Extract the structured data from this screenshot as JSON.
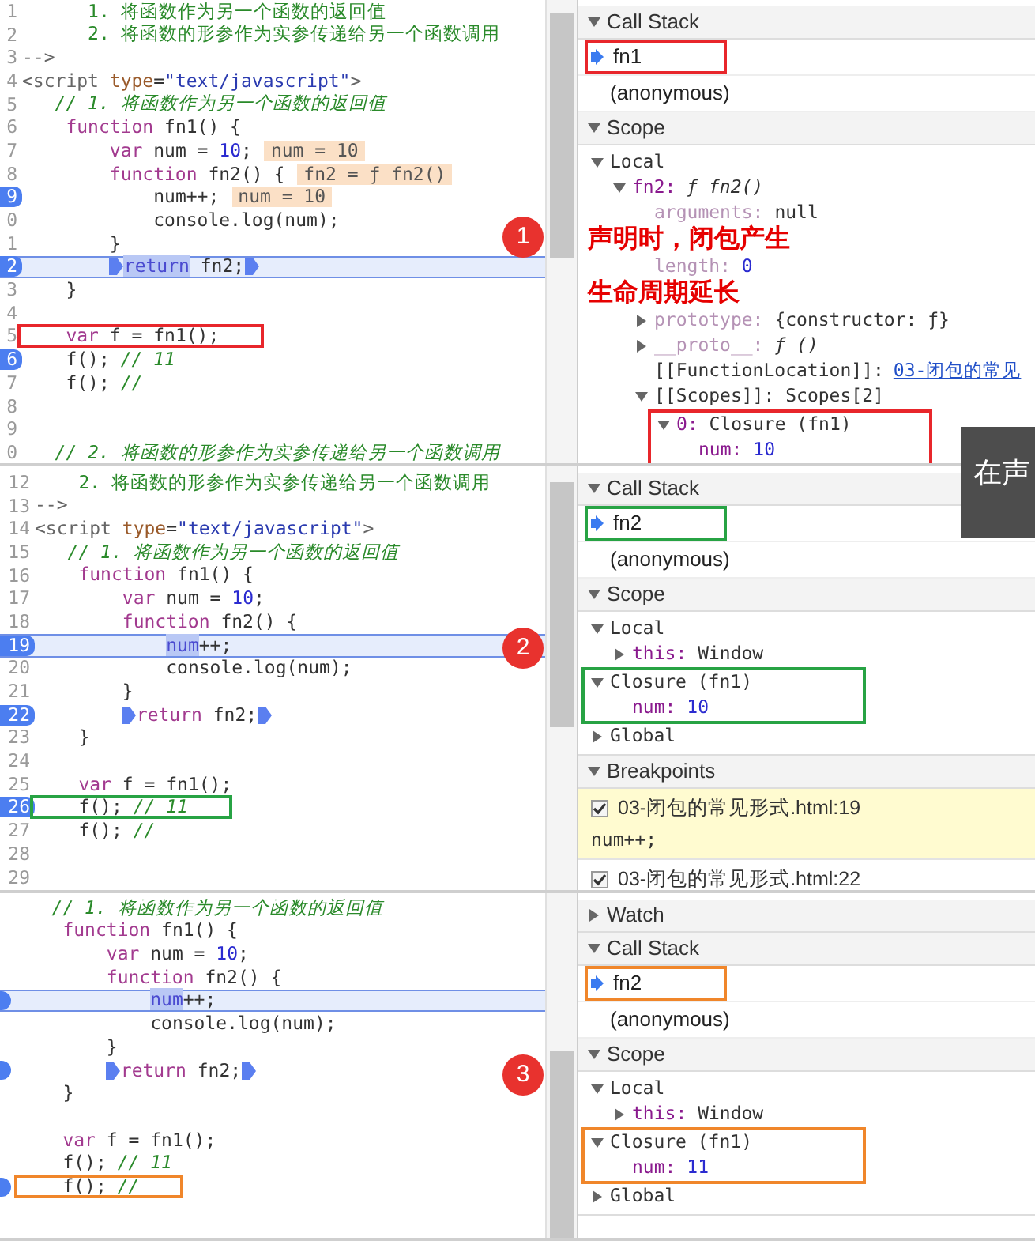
{
  "panels": [
    {
      "badge": "1",
      "color": "#e8262b",
      "code": [
        {
          "number": "1",
          "segments": [
            {
              "text": "      1. 将函数作为另一个函数的返回值",
              "kind": "doc"
            }
          ],
          "breakpoint": false,
          "current": false,
          "outlined": false
        },
        {
          "number": "2",
          "segments": [
            {
              "text": "      2. 将函数的形参作为实参传递给另一个函数调用",
              "kind": "doc"
            }
          ],
          "breakpoint": false,
          "current": false,
          "outlined": false
        },
        {
          "number": "3",
          "segments": [
            {
              "text": "-->",
              "kind": "tag"
            }
          ],
          "breakpoint": false,
          "current": false,
          "outlined": false
        },
        {
          "number": "4",
          "segments": [
            {
              "text": "<script",
              "kind": "tag"
            },
            {
              "text": " type",
              "kind": "attr"
            },
            {
              "text": "=",
              "kind": "plain"
            },
            {
              "text": "\"text/javascript\"",
              "kind": "string"
            },
            {
              "text": ">",
              "kind": "tag"
            }
          ],
          "breakpoint": false,
          "current": false,
          "outlined": false
        },
        {
          "number": "5",
          "segments": [
            {
              "text": "   // 1. 将函数作为另一个函数的返回值",
              "kind": "comment"
            }
          ],
          "breakpoint": false,
          "current": false,
          "outlined": false
        },
        {
          "number": "6",
          "segments": [
            {
              "text": "    function",
              "kind": "keyword"
            },
            {
              "text": " fn1() {",
              "kind": "plain"
            }
          ],
          "breakpoint": false,
          "current": false,
          "outlined": false
        },
        {
          "number": "7",
          "segments": [
            {
              "text": "        var",
              "kind": "keyword"
            },
            {
              "text": " num = ",
              "kind": "plain"
            },
            {
              "text": "10",
              "kind": "number"
            },
            {
              "text": ";",
              "kind": "plain"
            }
          ],
          "value": "num = 10",
          "breakpoint": false,
          "current": false,
          "outlined": false
        },
        {
          "number": "8",
          "segments": [
            {
              "text": "        function",
              "kind": "keyword"
            },
            {
              "text": " fn2() {",
              "kind": "plain"
            }
          ],
          "value": "fn2 = ƒ fn2()",
          "breakpoint": false,
          "current": false,
          "outlined": false
        },
        {
          "number": "9",
          "segments": [
            {
              "text": "            num++;",
              "kind": "plain"
            }
          ],
          "value": "num = 10",
          "breakpoint": true,
          "current": false,
          "outlined": false
        },
        {
          "number": "0",
          "segments": [
            {
              "text": "            console.log(num);",
              "kind": "plain"
            }
          ],
          "breakpoint": false,
          "current": false,
          "outlined": false
        },
        {
          "number": "1",
          "segments": [
            {
              "text": "        }",
              "kind": "plain"
            }
          ],
          "breakpoint": false,
          "current": false,
          "outlined": false
        },
        {
          "number": "2",
          "segments": [
            {
              "kind": "marker"
            },
            {
              "text": "        return",
              "kind": "selection"
            },
            {
              "text": " fn2;",
              "kind": "plain"
            },
            {
              "kind": "marker"
            }
          ],
          "breakpoint": true,
          "current": true,
          "outlined": false
        },
        {
          "number": "3",
          "segments": [
            {
              "text": "    }",
              "kind": "plain"
            }
          ],
          "breakpoint": false,
          "current": false,
          "outlined": false
        },
        {
          "number": "4",
          "breakpoint": false,
          "current": false,
          "outlined": false
        },
        {
          "number": "5",
          "segments": [
            {
              "text": "    var",
              "kind": "keyword"
            },
            {
              "text": " f = fn1();",
              "kind": "plain"
            }
          ],
          "breakpoint": false,
          "current": false,
          "outlined": true
        },
        {
          "number": "6",
          "segments": [
            {
              "text": "    f(); ",
              "kind": "plain"
            },
            {
              "text": "// 11",
              "kind": "comment"
            }
          ],
          "breakpoint": true,
          "current": false,
          "outlined": false
        },
        {
          "number": "7",
          "segments": [
            {
              "text": "    f(); ",
              "kind": "plain"
            },
            {
              "text": "//",
              "kind": "comment"
            }
          ],
          "breakpoint": false,
          "current": false,
          "outlined": false
        },
        {
          "number": "8",
          "breakpoint": false,
          "current": false,
          "outlined": false
        },
        {
          "number": "9",
          "breakpoint": false,
          "current": false,
          "outlined": false
        },
        {
          "number": "0",
          "segments": [
            {
              "text": "   // 2. 将函数的形参作为实参传递给另一个函数调用",
              "kind": "comment"
            }
          ],
          "breakpoint": false,
          "current": false,
          "outlined": false
        }
      ],
      "sidebar": [
        {
          "kind": "section",
          "title": "Call Stack",
          "expanded": true
        },
        {
          "kind": "frame",
          "name": "fn1",
          "active": true,
          "outlined": true
        },
        {
          "kind": "frame",
          "name": "(anonymous)",
          "active": false,
          "outlined": false
        },
        {
          "kind": "section",
          "title": "Scope",
          "expanded": true
        },
        {
          "kind": "tree",
          "nodes": [
            {
              "kind": "scope",
              "label": "Local",
              "expanded": true,
              "outlined": false,
              "children": [
                {
                  "kind": "property",
                  "key": "fn2:",
                  "value": {
                    "text": "ƒ fn2()",
                    "kind": "function"
                  },
                  "expanded": true,
                  "outlined": false,
                  "children": [
                    {
                      "kind": "hidden_property",
                      "key": "arguments:",
                      "value": {
                        "text": "null",
                        "kind": "object"
                      },
                      "outlined": false
                    },
                    {
                      "kind": "note",
                      "text": "声明时，闭包产生"
                    },
                    {
                      "kind": "hidden_property",
                      "key": "length:",
                      "value": {
                        "text": "0",
                        "kind": "number"
                      },
                      "outlined": false
                    },
                    {
                      "kind": "note",
                      "text": "生命周期延长"
                    },
                    {
                      "kind": "hidden_property",
                      "key": "prototype:",
                      "value": {
                        "text": "{constructor: ƒ}",
                        "kind": "object"
                      },
                      "expanded": false,
                      "outlined": false
                    },
                    {
                      "kind": "hidden_property",
                      "key": "__proto__:",
                      "value": {
                        "text": "ƒ ()",
                        "kind": "function"
                      },
                      "expanded": false,
                      "outlined": false
                    },
                    {
                      "kind": "internal",
                      "key": "[[FunctionLocation]]:",
                      "link": "03-闭包的常见",
                      "outlined": false
                    },
                    {
                      "kind": "internal",
                      "key": "[[Scopes]]:",
                      "value": {
                        "text": "Scopes[2]",
                        "kind": "object"
                      },
                      "expanded": true,
                      "outlined": false,
                      "children": [
                        {
                          "kind": "property",
                          "key": "0:",
                          "value": {
                            "text": "Closure (fn1)",
                            "kind": "object"
                          },
                          "expanded": true,
                          "outlined": true,
                          "children": [
                            {
                              "kind": "property",
                              "key": "num:",
                              "value": {
                                "text": "10",
                                "kind": "number"
                              },
                              "outlined": false
                            }
                          ]
                        }
                      ]
                    }
                  ]
                }
              ]
            }
          ]
        }
      ]
    },
    {
      "badge": "2",
      "color": "#27a344",
      "code": [
        {
          "number": "12",
          "segments": [
            {
              "text": "    2. 将函数的形参作为实参传递给另一个函数调用",
              "kind": "doc"
            }
          ],
          "breakpoint": false,
          "current": false,
          "outlined": false
        },
        {
          "number": "13",
          "segments": [
            {
              "text": "-->",
              "kind": "tag"
            }
          ],
          "breakpoint": false,
          "current": false,
          "outlined": false
        },
        {
          "number": "14",
          "segments": [
            {
              "text": "<script",
              "kind": "tag"
            },
            {
              "text": " type",
              "kind": "attr"
            },
            {
              "text": "=",
              "kind": "plain"
            },
            {
              "text": "\"text/javascript\"",
              "kind": "string"
            },
            {
              "text": ">",
              "kind": "tag"
            }
          ],
          "breakpoint": false,
          "current": false,
          "outlined": false
        },
        {
          "number": "15",
          "segments": [
            {
              "text": "   // 1. 将函数作为另一个函数的返回值",
              "kind": "comment"
            }
          ],
          "breakpoint": false,
          "current": false,
          "outlined": false
        },
        {
          "number": "16",
          "segments": [
            {
              "text": "    function",
              "kind": "keyword"
            },
            {
              "text": " fn1() {",
              "kind": "plain"
            }
          ],
          "breakpoint": false,
          "current": false,
          "outlined": false
        },
        {
          "number": "17",
          "segments": [
            {
              "text": "        var",
              "kind": "keyword"
            },
            {
              "text": " num = ",
              "kind": "plain"
            },
            {
              "text": "10",
              "kind": "number"
            },
            {
              "text": ";",
              "kind": "plain"
            }
          ],
          "breakpoint": false,
          "current": false,
          "outlined": false
        },
        {
          "number": "18",
          "segments": [
            {
              "text": "        function",
              "kind": "keyword"
            },
            {
              "text": " fn2() {",
              "kind": "plain"
            }
          ],
          "breakpoint": false,
          "current": false,
          "outlined": false
        },
        {
          "number": "19",
          "segments": [
            {
              "text": "            num",
              "kind": "selection"
            },
            {
              "text": "++;",
              "kind": "plain"
            }
          ],
          "breakpoint": true,
          "current": true,
          "outlined": false
        },
        {
          "number": "20",
          "segments": [
            {
              "text": "            console.log(num);",
              "kind": "plain"
            }
          ],
          "breakpoint": false,
          "current": false,
          "outlined": false
        },
        {
          "number": "21",
          "segments": [
            {
              "text": "        }",
              "kind": "plain"
            }
          ],
          "breakpoint": false,
          "current": false,
          "outlined": false
        },
        {
          "number": "22",
          "segments": [
            {
              "kind": "marker"
            },
            {
              "text": "        return",
              "kind": "keyword"
            },
            {
              "text": " fn2;",
              "kind": "plain"
            },
            {
              "kind": "marker"
            }
          ],
          "breakpoint": true,
          "current": false,
          "outlined": false
        },
        {
          "number": "23",
          "segments": [
            {
              "text": "    }",
              "kind": "plain"
            }
          ],
          "breakpoint": false,
          "current": false,
          "outlined": false
        },
        {
          "number": "24",
          "breakpoint": false,
          "current": false,
          "outlined": false
        },
        {
          "number": "25",
          "segments": [
            {
              "text": "    var",
              "kind": "keyword"
            },
            {
              "text": " f = fn1();",
              "kind": "plain"
            }
          ],
          "breakpoint": false,
          "current": false,
          "outlined": false
        },
        {
          "number": "26",
          "segments": [
            {
              "text": "    f(); ",
              "kind": "plain"
            },
            {
              "text": "// 11",
              "kind": "comment"
            }
          ],
          "breakpoint": true,
          "current": false,
          "outlined": true
        },
        {
          "number": "27",
          "segments": [
            {
              "text": "    f(); ",
              "kind": "plain"
            },
            {
              "text": "//",
              "kind": "comment"
            }
          ],
          "breakpoint": false,
          "current": false,
          "outlined": false
        },
        {
          "number": "28",
          "breakpoint": false,
          "current": false,
          "outlined": false
        },
        {
          "number": "29",
          "breakpoint": false,
          "current": false,
          "outlined": false
        }
      ],
      "sidebar": [
        {
          "kind": "section",
          "title": "Call Stack",
          "expanded": true
        },
        {
          "kind": "frame",
          "name": "fn2",
          "active": true,
          "outlined": true
        },
        {
          "kind": "frame",
          "name": "(anonymous)",
          "active": false,
          "outlined": false
        },
        {
          "kind": "section",
          "title": "Scope",
          "expanded": true
        },
        {
          "kind": "tree",
          "nodes": [
            {
              "kind": "scope",
              "label": "Local",
              "expanded": true,
              "outlined": false,
              "children": [
                {
                  "kind": "property",
                  "key": "this:",
                  "value": {
                    "text": "Window",
                    "kind": "object"
                  },
                  "expanded": false,
                  "outlined": false
                }
              ]
            },
            {
              "kind": "scope",
              "label": "Closure (fn1)",
              "expanded": true,
              "outlined": true,
              "children": [
                {
                  "kind": "property",
                  "key": "num:",
                  "value": {
                    "text": "10",
                    "kind": "number"
                  },
                  "outlined": false
                }
              ]
            },
            {
              "kind": "scope",
              "label": "Global",
              "expanded": false,
              "outlined": false
            }
          ]
        },
        {
          "kind": "section",
          "title": "Breakpoints",
          "expanded": true
        },
        {
          "kind": "breakpoint",
          "location": "03-闭包的常见形式.html:19",
          "code": "num++;",
          "checked": true,
          "hit": true
        },
        {
          "kind": "breakpoint",
          "location": "03-闭包的常见形式.html:22",
          "checked": true,
          "hit": false
        }
      ]
    },
    {
      "badge": "3",
      "color": "#f0862a",
      "code": [
        {
          "segments": [
            {
              "text": "   // 1. 将函数作为另一个函数的返回值",
              "kind": "comment"
            }
          ],
          "breakpoint": false,
          "current": false,
          "outlined": false
        },
        {
          "segments": [
            {
              "text": "    function",
              "kind": "keyword"
            },
            {
              "text": " fn1() {",
              "kind": "plain"
            }
          ],
          "breakpoint": false,
          "current": false,
          "outlined": false
        },
        {
          "segments": [
            {
              "text": "        var",
              "kind": "keyword"
            },
            {
              "text": " num = ",
              "kind": "plain"
            },
            {
              "text": "10",
              "kind": "number"
            },
            {
              "text": ";",
              "kind": "plain"
            }
          ],
          "breakpoint": false,
          "current": false,
          "outlined": false
        },
        {
          "segments": [
            {
              "text": "        function",
              "kind": "keyword"
            },
            {
              "text": " fn2() {",
              "kind": "plain"
            }
          ],
          "breakpoint": false,
          "current": false,
          "outlined": false
        },
        {
          "segments": [
            {
              "text": "            num",
              "kind": "selection"
            },
            {
              "text": "++;",
              "kind": "plain"
            }
          ],
          "breakpoint": true,
          "current": true,
          "outlined": false
        },
        {
          "segments": [
            {
              "text": "            console.log(num);",
              "kind": "plain"
            }
          ],
          "breakpoint": false,
          "current": false,
          "outlined": false
        },
        {
          "segments": [
            {
              "text": "        }",
              "kind": "plain"
            }
          ],
          "breakpoint": false,
          "current": false,
          "outlined": false
        },
        {
          "segments": [
            {
              "kind": "marker"
            },
            {
              "text": "        return",
              "kind": "keyword"
            },
            {
              "text": " fn2;",
              "kind": "plain"
            },
            {
              "kind": "marker"
            }
          ],
          "breakpoint": true,
          "current": false,
          "outlined": false
        },
        {
          "segments": [
            {
              "text": "    }",
              "kind": "plain"
            }
          ],
          "breakpoint": false,
          "current": false,
          "outlined": false
        },
        {
          "breakpoint": false,
          "current": false,
          "outlined": false
        },
        {
          "segments": [
            {
              "text": "    var",
              "kind": "keyword"
            },
            {
              "text": " f = fn1();",
              "kind": "plain"
            }
          ],
          "breakpoint": false,
          "current": false,
          "outlined": false
        },
        {
          "segments": [
            {
              "text": "    f(); ",
              "kind": "plain"
            },
            {
              "text": "// 11",
              "kind": "comment"
            }
          ],
          "breakpoint": false,
          "current": false,
          "outlined": false
        },
        {
          "segments": [
            {
              "text": "    f(); ",
              "kind": "plain"
            },
            {
              "text": "//",
              "kind": "comment"
            }
          ],
          "breakpoint": true,
          "current": false,
          "outlined": true
        }
      ],
      "sidebar": [
        {
          "kind": "section",
          "title": "Watch",
          "expanded": false
        },
        {
          "kind": "section",
          "title": "Call Stack",
          "expanded": true
        },
        {
          "kind": "frame",
          "name": "fn2",
          "active": true,
          "outlined": true
        },
        {
          "kind": "frame",
          "name": "(anonymous)",
          "active": false,
          "outlined": false
        },
        {
          "kind": "section",
          "title": "Scope",
          "expanded": true
        },
        {
          "kind": "tree",
          "nodes": [
            {
              "kind": "scope",
              "label": "Local",
              "expanded": true,
              "outlined": false,
              "children": [
                {
                  "kind": "property",
                  "key": "this:",
                  "value": {
                    "text": "Window",
                    "kind": "object"
                  },
                  "expanded": false,
                  "outlined": false
                }
              ]
            },
            {
              "kind": "scope",
              "label": "Closure (fn1)",
              "expanded": true,
              "outlined": true,
              "children": [
                {
                  "kind": "property",
                  "key": "num:",
                  "value": {
                    "text": "11",
                    "kind": "number"
                  },
                  "outlined": false
                }
              ]
            },
            {
              "kind": "scope",
              "label": "Global",
              "expanded": false,
              "outlined": false
            }
          ]
        }
      ]
    }
  ],
  "tooltip": {
    "text": "在声"
  }
}
